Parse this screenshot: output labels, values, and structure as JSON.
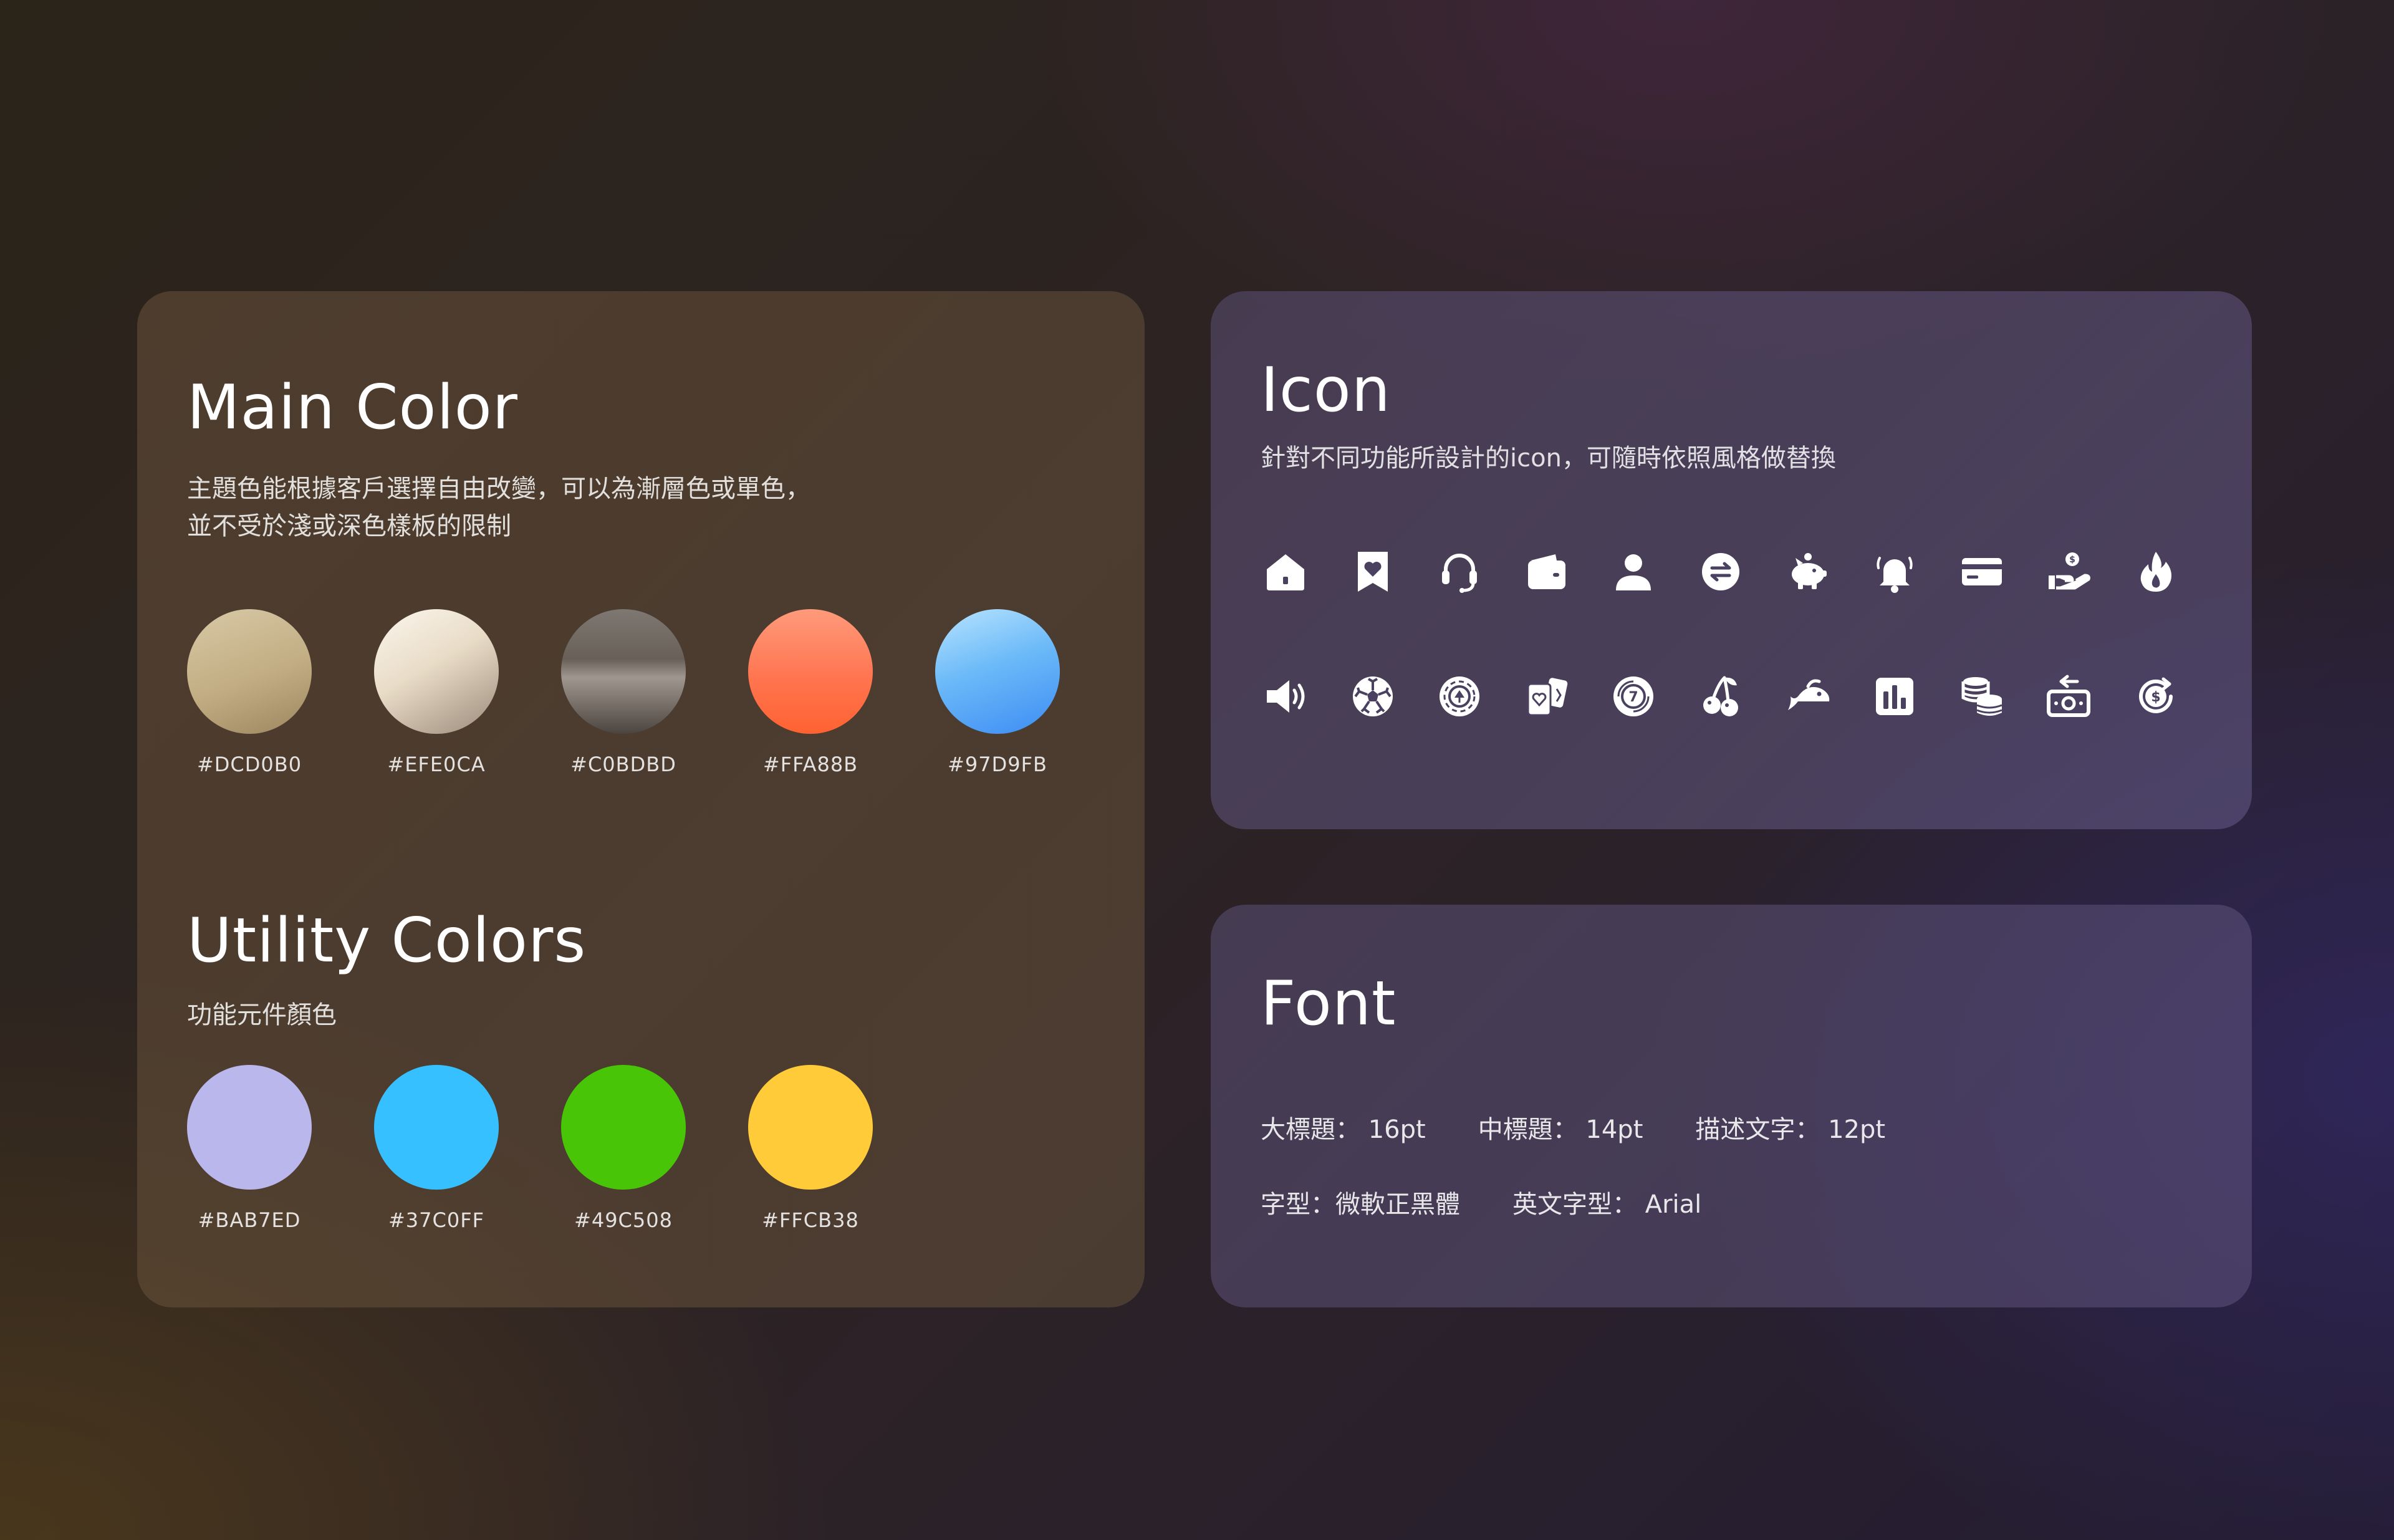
{
  "main_color": {
    "title": "Main Color",
    "desc_line1": "主題色能根據客戶選擇自由改變，可以為漸層色或單色，",
    "desc_line2": "並不受於淺或深色樣板的限制",
    "swatches": [
      {
        "hex": "#DCD0B0",
        "gradient": "linear-gradient(160deg,#d8c9a6 0%,#c2ad83 55%,#9d8660 100%)"
      },
      {
        "hex": "#EFE0CA",
        "gradient": "linear-gradient(150deg,#fbf6ee 0%,#e9dcc7 45%,#9a8a7a 100%)"
      },
      {
        "hex": "#C0BDBD",
        "gradient": "linear-gradient(180deg,#7f7872 0%,#686058 40%,#a09690 55%,#4c443e 100%)"
      },
      {
        "hex": "#FFA88B",
        "gradient": "linear-gradient(180deg,#ff9a7b 0%,#ff7550 55%,#ff6231 100%)"
      },
      {
        "hex": "#97D9FB",
        "gradient": "linear-gradient(160deg,#b9e4ff 0%,#6cbaf8 45%,#3c8cf4 100%)"
      }
    ]
  },
  "utility_colors": {
    "title": "Utility Colors",
    "desc": "功能元件顏色",
    "swatches": [
      {
        "hex": "#BAB7ED",
        "color": "#BAB7ED"
      },
      {
        "hex": "#37C0FF",
        "color": "#37C0FF"
      },
      {
        "hex": "#49C508",
        "color": "#49C508"
      },
      {
        "hex": "#FFCB38",
        "color": "#FFCB38"
      }
    ]
  },
  "icon_section": {
    "title": "Icon",
    "desc": "針對不同功能所設計的icon，可隨時依照風格做替換",
    "row1": [
      "home-icon",
      "bookmark-heart-icon",
      "headset-icon",
      "wallet-icon",
      "user-icon",
      "exchange-icon",
      "piggy-bank-icon",
      "bell-icon",
      "credit-card-icon",
      "hand-coin-icon",
      "fire-icon"
    ],
    "row2": [
      "speaker-icon",
      "soccer-ball-icon",
      "poker-chip-icon",
      "playing-cards-icon",
      "lottery-ball-icon",
      "cherry-icon",
      "fish-icon",
      "bar-chart-icon",
      "coin-stack-icon",
      "cash-withdraw-icon",
      "dollar-refresh-icon"
    ]
  },
  "font_section": {
    "title": "Font",
    "large_title": "大標題： 16pt",
    "mid_title": "中標題： 14pt",
    "body_text": "描述文字： 12pt",
    "font_family": "字型：微軟正黑體",
    "english_font": "英文字型： Arial"
  }
}
